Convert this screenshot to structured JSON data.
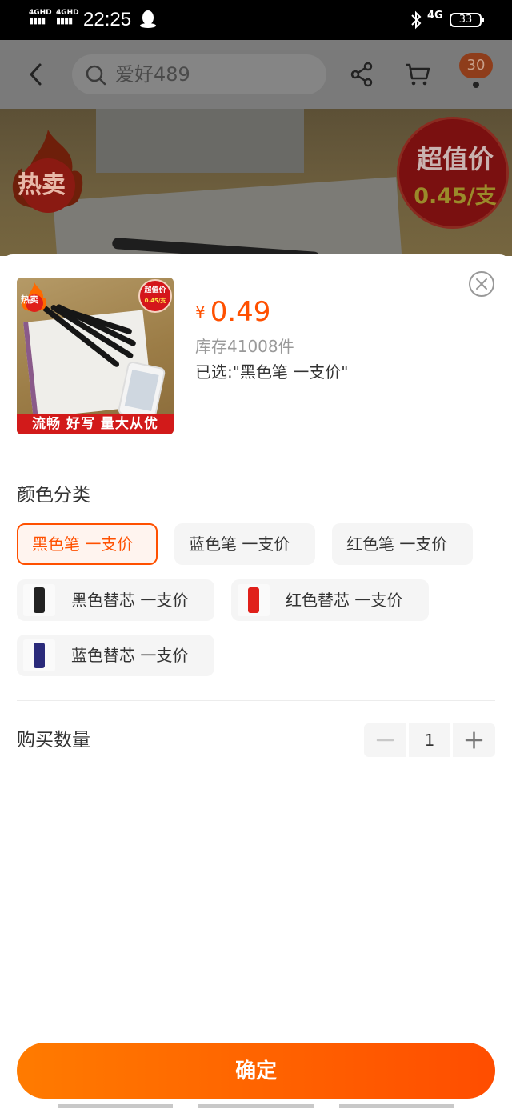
{
  "status_bar": {
    "sim1": "4GHD",
    "sim2": "4GHD",
    "time": "22:25",
    "network": "4G",
    "battery": "33"
  },
  "header": {
    "search_text": "爱好489",
    "menu_badge": "30"
  },
  "banner": {
    "hot_label": "热卖",
    "price_title": "超值价",
    "price_value": "0.45/支"
  },
  "sku": {
    "thumb": {
      "hot_label": "热卖",
      "price_title": "超值价",
      "price_value": "0.45/支",
      "caption": "流畅 好写 量大从优"
    },
    "currency": "¥",
    "price": "0.49",
    "stock": "库存41008件",
    "selected": "已选:\"黑色笔  一支价\""
  },
  "color_section": {
    "title": "颜色分类",
    "options": [
      {
        "label": "黑色笔  一支价",
        "selected": true
      },
      {
        "label": "蓝色笔  一支价",
        "selected": false
      },
      {
        "label": "红色笔  一支价",
        "selected": false
      },
      {
        "label": "黑色替芯  一支价",
        "selected": false,
        "thumb_color": "#222222"
      },
      {
        "label": "红色替芯  一支价",
        "selected": false,
        "thumb_color": "#e0201a"
      },
      {
        "label": "蓝色替芯  一支价",
        "selected": false,
        "thumb_color": "#2a2a7a"
      }
    ]
  },
  "quantity": {
    "label": "购买数量",
    "value": "1"
  },
  "confirm_label": "确定",
  "colors": {
    "accent": "#ff5000",
    "button_start": "#ff7b00",
    "button_end": "#ff4d00"
  }
}
